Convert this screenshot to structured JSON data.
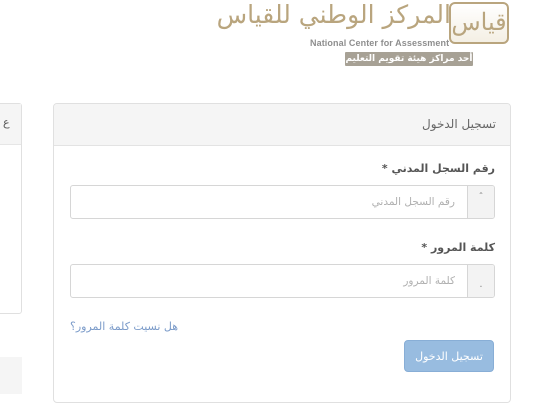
{
  "logo": {
    "arabic_name": "المركز الوطني للقياس",
    "mark_text": "قياس",
    "english_name": "National Center for Assessment",
    "tagline": "أحد مراكز هيئة تقويم التعليم",
    "color": "#b9a57e"
  },
  "side_panel": {
    "title": "ع"
  },
  "login": {
    "title": "تسجيل الدخول",
    "national_id": {
      "label": "رقم السجل المدني",
      "required_mark": "*",
      "placeholder": "رقم السجل المدني",
      "value": "",
      "icon": "id-card-icon"
    },
    "password": {
      "label": "كلمة المرور",
      "required_mark": "*",
      "placeholder": "كلمة المرور",
      "value": "",
      "icon": "lock-icon"
    },
    "forgot_password": "هل نسيت كلمة المرور؟",
    "submit_label": "تسجيل الدخول"
  },
  "colors": {
    "button": "#98bce0",
    "link": "#7b9bc9",
    "panel_header": "#f5f5f5"
  }
}
